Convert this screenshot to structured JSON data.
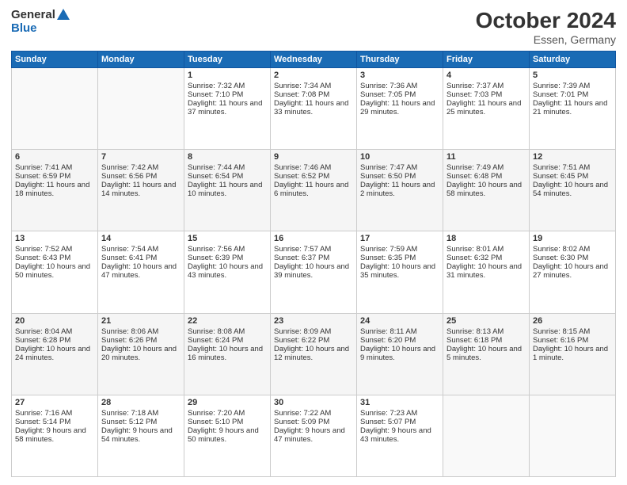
{
  "header": {
    "logo_general": "General",
    "logo_blue": "Blue",
    "title": "October 2024",
    "subtitle": "Essen, Germany"
  },
  "days_of_week": [
    "Sunday",
    "Monday",
    "Tuesday",
    "Wednesday",
    "Thursday",
    "Friday",
    "Saturday"
  ],
  "weeks": [
    [
      {
        "day": "",
        "sunrise": "",
        "sunset": "",
        "daylight": ""
      },
      {
        "day": "",
        "sunrise": "",
        "sunset": "",
        "daylight": ""
      },
      {
        "day": "1",
        "sunrise": "Sunrise: 7:32 AM",
        "sunset": "Sunset: 7:10 PM",
        "daylight": "Daylight: 11 hours and 37 minutes."
      },
      {
        "day": "2",
        "sunrise": "Sunrise: 7:34 AM",
        "sunset": "Sunset: 7:08 PM",
        "daylight": "Daylight: 11 hours and 33 minutes."
      },
      {
        "day": "3",
        "sunrise": "Sunrise: 7:36 AM",
        "sunset": "Sunset: 7:05 PM",
        "daylight": "Daylight: 11 hours and 29 minutes."
      },
      {
        "day": "4",
        "sunrise": "Sunrise: 7:37 AM",
        "sunset": "Sunset: 7:03 PM",
        "daylight": "Daylight: 11 hours and 25 minutes."
      },
      {
        "day": "5",
        "sunrise": "Sunrise: 7:39 AM",
        "sunset": "Sunset: 7:01 PM",
        "daylight": "Daylight: 11 hours and 21 minutes."
      }
    ],
    [
      {
        "day": "6",
        "sunrise": "Sunrise: 7:41 AM",
        "sunset": "Sunset: 6:59 PM",
        "daylight": "Daylight: 11 hours and 18 minutes."
      },
      {
        "day": "7",
        "sunrise": "Sunrise: 7:42 AM",
        "sunset": "Sunset: 6:56 PM",
        "daylight": "Daylight: 11 hours and 14 minutes."
      },
      {
        "day": "8",
        "sunrise": "Sunrise: 7:44 AM",
        "sunset": "Sunset: 6:54 PM",
        "daylight": "Daylight: 11 hours and 10 minutes."
      },
      {
        "day": "9",
        "sunrise": "Sunrise: 7:46 AM",
        "sunset": "Sunset: 6:52 PM",
        "daylight": "Daylight: 11 hours and 6 minutes."
      },
      {
        "day": "10",
        "sunrise": "Sunrise: 7:47 AM",
        "sunset": "Sunset: 6:50 PM",
        "daylight": "Daylight: 11 hours and 2 minutes."
      },
      {
        "day": "11",
        "sunrise": "Sunrise: 7:49 AM",
        "sunset": "Sunset: 6:48 PM",
        "daylight": "Daylight: 10 hours and 58 minutes."
      },
      {
        "day": "12",
        "sunrise": "Sunrise: 7:51 AM",
        "sunset": "Sunset: 6:45 PM",
        "daylight": "Daylight: 10 hours and 54 minutes."
      }
    ],
    [
      {
        "day": "13",
        "sunrise": "Sunrise: 7:52 AM",
        "sunset": "Sunset: 6:43 PM",
        "daylight": "Daylight: 10 hours and 50 minutes."
      },
      {
        "day": "14",
        "sunrise": "Sunrise: 7:54 AM",
        "sunset": "Sunset: 6:41 PM",
        "daylight": "Daylight: 10 hours and 47 minutes."
      },
      {
        "day": "15",
        "sunrise": "Sunrise: 7:56 AM",
        "sunset": "Sunset: 6:39 PM",
        "daylight": "Daylight: 10 hours and 43 minutes."
      },
      {
        "day": "16",
        "sunrise": "Sunrise: 7:57 AM",
        "sunset": "Sunset: 6:37 PM",
        "daylight": "Daylight: 10 hours and 39 minutes."
      },
      {
        "day": "17",
        "sunrise": "Sunrise: 7:59 AM",
        "sunset": "Sunset: 6:35 PM",
        "daylight": "Daylight: 10 hours and 35 minutes."
      },
      {
        "day": "18",
        "sunrise": "Sunrise: 8:01 AM",
        "sunset": "Sunset: 6:32 PM",
        "daylight": "Daylight: 10 hours and 31 minutes."
      },
      {
        "day": "19",
        "sunrise": "Sunrise: 8:02 AM",
        "sunset": "Sunset: 6:30 PM",
        "daylight": "Daylight: 10 hours and 27 minutes."
      }
    ],
    [
      {
        "day": "20",
        "sunrise": "Sunrise: 8:04 AM",
        "sunset": "Sunset: 6:28 PM",
        "daylight": "Daylight: 10 hours and 24 minutes."
      },
      {
        "day": "21",
        "sunrise": "Sunrise: 8:06 AM",
        "sunset": "Sunset: 6:26 PM",
        "daylight": "Daylight: 10 hours and 20 minutes."
      },
      {
        "day": "22",
        "sunrise": "Sunrise: 8:08 AM",
        "sunset": "Sunset: 6:24 PM",
        "daylight": "Daylight: 10 hours and 16 minutes."
      },
      {
        "day": "23",
        "sunrise": "Sunrise: 8:09 AM",
        "sunset": "Sunset: 6:22 PM",
        "daylight": "Daylight: 10 hours and 12 minutes."
      },
      {
        "day": "24",
        "sunrise": "Sunrise: 8:11 AM",
        "sunset": "Sunset: 6:20 PM",
        "daylight": "Daylight: 10 hours and 9 minutes."
      },
      {
        "day": "25",
        "sunrise": "Sunrise: 8:13 AM",
        "sunset": "Sunset: 6:18 PM",
        "daylight": "Daylight: 10 hours and 5 minutes."
      },
      {
        "day": "26",
        "sunrise": "Sunrise: 8:15 AM",
        "sunset": "Sunset: 6:16 PM",
        "daylight": "Daylight: 10 hours and 1 minute."
      }
    ],
    [
      {
        "day": "27",
        "sunrise": "Sunrise: 7:16 AM",
        "sunset": "Sunset: 5:14 PM",
        "daylight": "Daylight: 9 hours and 58 minutes."
      },
      {
        "day": "28",
        "sunrise": "Sunrise: 7:18 AM",
        "sunset": "Sunset: 5:12 PM",
        "daylight": "Daylight: 9 hours and 54 minutes."
      },
      {
        "day": "29",
        "sunrise": "Sunrise: 7:20 AM",
        "sunset": "Sunset: 5:10 PM",
        "daylight": "Daylight: 9 hours and 50 minutes."
      },
      {
        "day": "30",
        "sunrise": "Sunrise: 7:22 AM",
        "sunset": "Sunset: 5:09 PM",
        "daylight": "Daylight: 9 hours and 47 minutes."
      },
      {
        "day": "31",
        "sunrise": "Sunrise: 7:23 AM",
        "sunset": "Sunset: 5:07 PM",
        "daylight": "Daylight: 9 hours and 43 minutes."
      },
      {
        "day": "",
        "sunrise": "",
        "sunset": "",
        "daylight": ""
      },
      {
        "day": "",
        "sunrise": "",
        "sunset": "",
        "daylight": ""
      }
    ]
  ]
}
